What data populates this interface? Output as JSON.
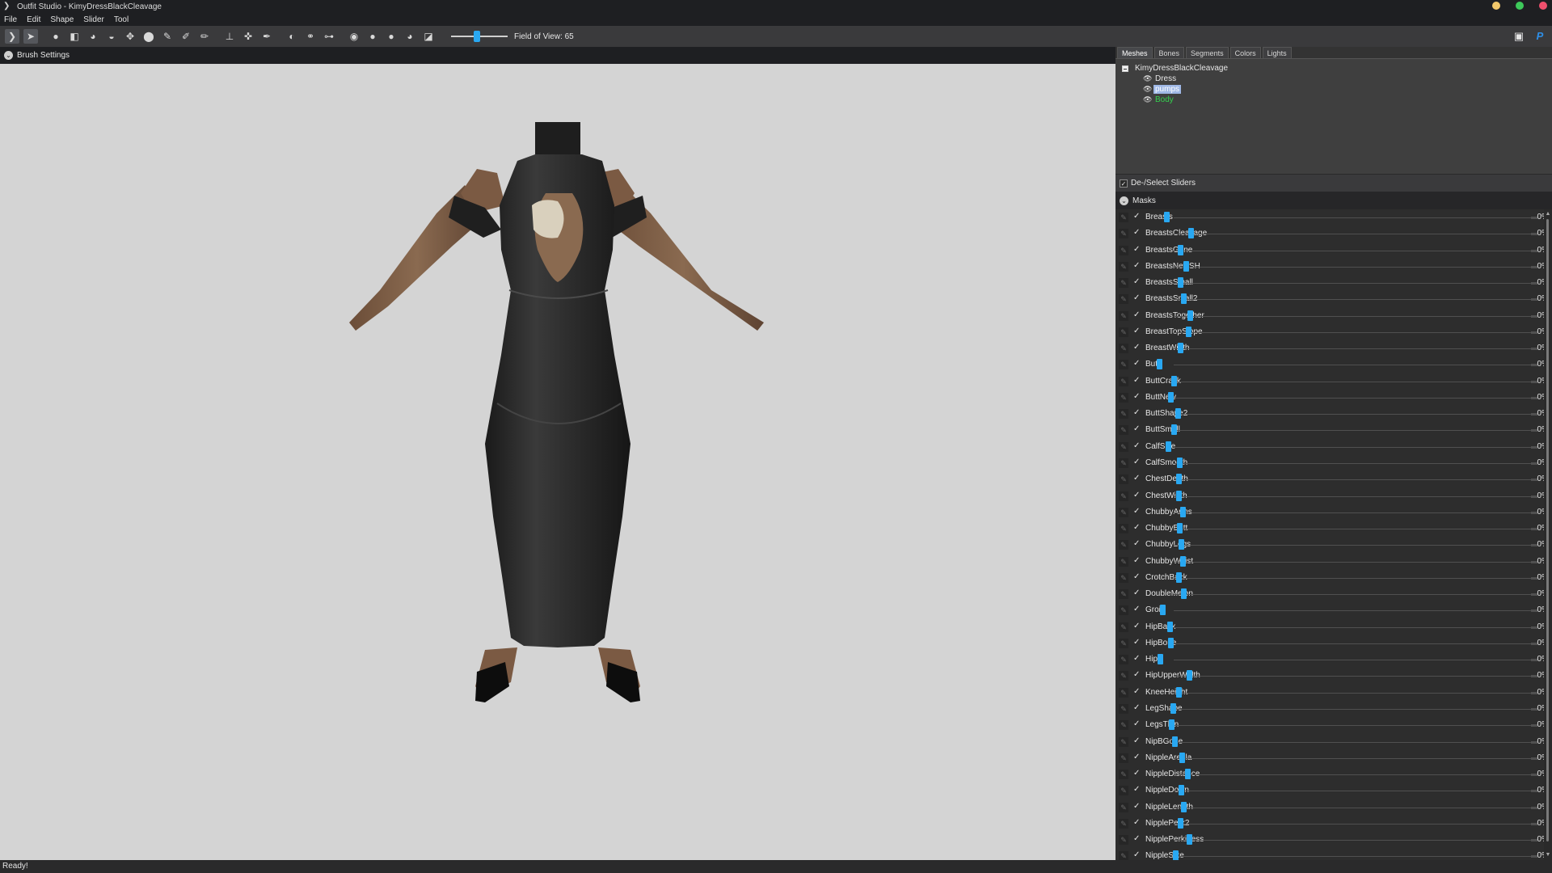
{
  "window": {
    "title": "Outfit Studio - KimyDressBlackCleavage",
    "controls": [
      {
        "name": "minimize",
        "color": "#f3c86b"
      },
      {
        "name": "maximize",
        "color": "#3dc95a"
      },
      {
        "name": "close",
        "color": "#f0506e"
      }
    ]
  },
  "menu": [
    "File",
    "Edit",
    "Shape",
    "Slider",
    "Tool"
  ],
  "toolbar": {
    "tools": [
      "select-tool-icon",
      "transform-tool-icon",
      "brush-standard-icon",
      "mask-brush-icon",
      "inflate-brush-icon",
      "deflate-brush-icon",
      "move-brush-icon",
      "smooth-brush-icon",
      "undiff-brush-icon",
      "weight-brush-icon",
      "color-brush-icon",
      "alpha-brush-icon",
      "pivot-icon",
      "anchor-icon",
      "collapse-vertex-icon",
      "mirror-icon",
      "connect-icon",
      "edge-icon",
      "wireframe-icon",
      "lighting-icon",
      "texture-icon",
      "vertex-color-icon",
      "ortho-view-icon"
    ],
    "fov_label": "Field of View: 65",
    "fov_value": 65,
    "fov_range": [
      10,
      180
    ],
    "right_icons": [
      "discord-icon",
      "paypal-icon"
    ]
  },
  "brush_settings": {
    "label": "Brush Settings"
  },
  "panel": {
    "tabs": [
      "Meshes",
      "Bones",
      "Segments",
      "Colors",
      "Lights"
    ],
    "active_tab": "Meshes",
    "tree": {
      "root": "KimyDressBlackCleavage",
      "children": [
        {
          "name": "Dress",
          "state": "normal"
        },
        {
          "name": "pumps",
          "state": "selected"
        },
        {
          "name": "Body",
          "state": "reference"
        }
      ]
    },
    "deselect_label": "De-/Select Sliders",
    "masks_label": "Masks",
    "sliders": [
      {
        "name": "Breasts",
        "value": "0%"
      },
      {
        "name": "BreastsCleavage",
        "value": "0%"
      },
      {
        "name": "BreastsGone",
        "value": "0%"
      },
      {
        "name": "BreastsNewSH",
        "value": "0%"
      },
      {
        "name": "BreastsSmall",
        "value": "0%"
      },
      {
        "name": "BreastsSmall2",
        "value": "0%"
      },
      {
        "name": "BreastsTogether",
        "value": "0%"
      },
      {
        "name": "BreastTopSlope",
        "value": "0%"
      },
      {
        "name": "BreastWidth",
        "value": "0%"
      },
      {
        "name": "Butt",
        "value": "0%"
      },
      {
        "name": "ButtCrack",
        "value": "0%"
      },
      {
        "name": "ButtNew",
        "value": "0%"
      },
      {
        "name": "ButtShape2",
        "value": "0%"
      },
      {
        "name": "ButtSmall",
        "value": "0%"
      },
      {
        "name": "CalfSize",
        "value": "0%"
      },
      {
        "name": "CalfSmooth",
        "value": "0%"
      },
      {
        "name": "ChestDepth",
        "value": "0%"
      },
      {
        "name": "ChestWidth",
        "value": "0%"
      },
      {
        "name": "ChubbyArms",
        "value": "0%"
      },
      {
        "name": "ChubbyButt",
        "value": "0%"
      },
      {
        "name": "ChubbyLegs",
        "value": "0%"
      },
      {
        "name": "ChubbyWaist",
        "value": "0%"
      },
      {
        "name": "CrotchBack",
        "value": "0%"
      },
      {
        "name": "DoubleMelon",
        "value": "0%"
      },
      {
        "name": "Groin",
        "value": "0%"
      },
      {
        "name": "HipBack",
        "value": "0%"
      },
      {
        "name": "HipBone",
        "value": "0%"
      },
      {
        "name": "Hips",
        "value": "0%"
      },
      {
        "name": "HipUpperWidth",
        "value": "0%"
      },
      {
        "name": "KneeHeight",
        "value": "0%"
      },
      {
        "name": "LegShape",
        "value": "0%"
      },
      {
        "name": "LegsThin",
        "value": "0%"
      },
      {
        "name": "NipBGone",
        "value": "0%"
      },
      {
        "name": "NippleAreola",
        "value": "0%"
      },
      {
        "name": "NippleDistance",
        "value": "0%"
      },
      {
        "name": "NippleDown",
        "value": "0%"
      },
      {
        "name": "NippleLength",
        "value": "0%"
      },
      {
        "name": "NipplePerk2",
        "value": "0%"
      },
      {
        "name": "NipplePerkiness",
        "value": "0%"
      },
      {
        "name": "NippleSize",
        "value": "0%"
      }
    ]
  },
  "status": "Ready!"
}
